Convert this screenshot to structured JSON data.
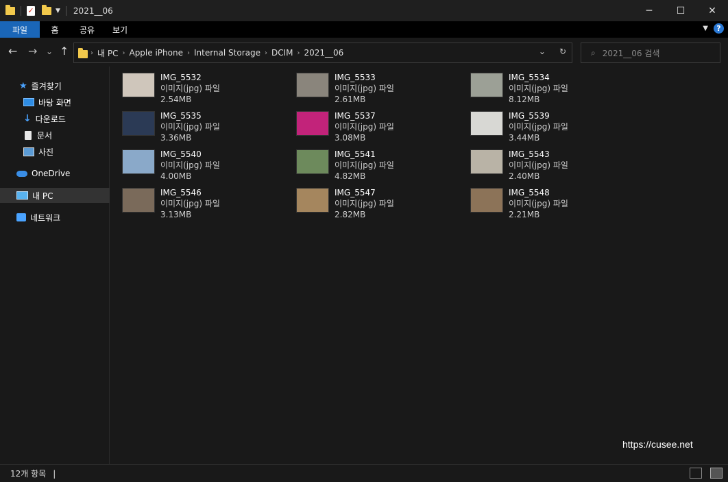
{
  "window": {
    "title": "2021__06"
  },
  "titlebar": {
    "minimize_glyph": "─",
    "maximize_glyph": "☐",
    "close_glyph": "✕"
  },
  "ribbon": {
    "tabs": [
      "파일",
      "홈",
      "공유",
      "보기"
    ],
    "help_glyph": "?"
  },
  "nav": {
    "back_glyph": "←",
    "forward_glyph": "→",
    "recent_glyph": "⌄",
    "up_glyph": "↑",
    "breadcrumb": [
      "내 PC",
      "Apple iPhone",
      "Internal Storage",
      "DCIM",
      "2021__06"
    ],
    "dropdown_glyph": "⌄",
    "refresh_glyph": "↻"
  },
  "search": {
    "placeholder": "2021__06 검색"
  },
  "sidebar": {
    "quick_access": "즐겨찾기",
    "pinned": [
      {
        "label": "바탕 화면",
        "icon": "desktop-icon"
      },
      {
        "label": "다운로드",
        "icon": "download-icon"
      },
      {
        "label": "문서",
        "icon": "document-icon"
      },
      {
        "label": "사진",
        "icon": "pictures-icon"
      }
    ],
    "onedrive": "OneDrive",
    "this_pc": "내 PC",
    "network": "네트워크"
  },
  "files": [
    {
      "name": "IMG_5532",
      "type": "이미지(jpg) 파일",
      "size": "2.54MB",
      "thumb": "#cfc6bb"
    },
    {
      "name": "IMG_5533",
      "type": "이미지(jpg) 파일",
      "size": "2.61MB",
      "thumb": "#8a857c"
    },
    {
      "name": "IMG_5534",
      "type": "이미지(jpg) 파일",
      "size": "8.12MB",
      "thumb": "#9ca096"
    },
    {
      "name": "IMG_5535",
      "type": "이미지(jpg) 파일",
      "size": "3.36MB",
      "thumb": "#2b3a55"
    },
    {
      "name": "IMG_5537",
      "type": "이미지(jpg) 파일",
      "size": "3.08MB",
      "thumb": "#c2237a"
    },
    {
      "name": "IMG_5539",
      "type": "이미지(jpg) 파일",
      "size": "3.44MB",
      "thumb": "#d8d8d4"
    },
    {
      "name": "IMG_5540",
      "type": "이미지(jpg) 파일",
      "size": "4.00MB",
      "thumb": "#8aa9c9"
    },
    {
      "name": "IMG_5541",
      "type": "이미지(jpg) 파일",
      "size": "4.82MB",
      "thumb": "#6d8a5c"
    },
    {
      "name": "IMG_5543",
      "type": "이미지(jpg) 파일",
      "size": "2.40MB",
      "thumb": "#b9b3a6"
    },
    {
      "name": "IMG_5546",
      "type": "이미지(jpg) 파일",
      "size": "3.13MB",
      "thumb": "#7a6a5a"
    },
    {
      "name": "IMG_5547",
      "type": "이미지(jpg) 파일",
      "size": "2.82MB",
      "thumb": "#a5865e"
    },
    {
      "name": "IMG_5548",
      "type": "이미지(jpg) 파일",
      "size": "2.21MB",
      "thumb": "#8c7358"
    }
  ],
  "status": {
    "item_count": "12개 항목",
    "separator": "|"
  },
  "watermark": "https://cusee.net"
}
